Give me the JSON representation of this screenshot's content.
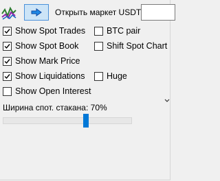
{
  "toolbar": {
    "app_icon": "chart-signal-icon",
    "action_icon": "arrow-right-icon",
    "open_market_label": "Открыть маркет USDT-",
    "market_input_value": ""
  },
  "options": {
    "show_spot_trades": {
      "label": "Show Spot Trades",
      "checked": true
    },
    "btc_pair": {
      "label": "BTC pair",
      "checked": false
    },
    "show_spot_book": {
      "label": "Show Spot Book",
      "checked": true
    },
    "shift_spot_chart": {
      "label": "Shift Spot Chart",
      "checked": false
    },
    "show_mark_price": {
      "label": "Show Mark Price",
      "checked": true
    },
    "show_liquidations": {
      "label": "Show Liquidations",
      "checked": true
    },
    "huge": {
      "label": "Huge",
      "checked": false
    },
    "show_open_interest": {
      "label": "Show Open Interest",
      "checked": false
    }
  },
  "spot_book_width": {
    "label": "Ширина спот. стакана: 70%",
    "value_fraction": 0.65
  },
  "colors": {
    "accent": "#0078d7",
    "button_bg": "#cce4f7",
    "button_border": "#4a90d9",
    "window_bg": "#f0f0f0"
  }
}
